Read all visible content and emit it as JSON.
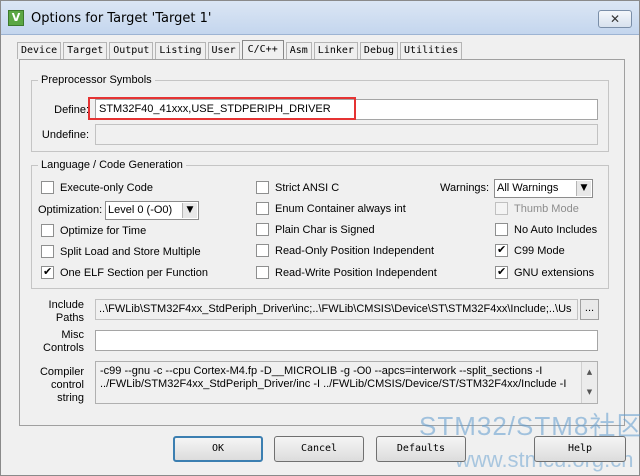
{
  "window": {
    "title": "Options for Target 'Target 1'",
    "close_glyph": "✕",
    "app_icon_letter": "V"
  },
  "tabs": [
    "Device",
    "Target",
    "Output",
    "Listing",
    "User",
    "C/C++",
    "Asm",
    "Linker",
    "Debug",
    "Utilities"
  ],
  "active_tab": "C/C++",
  "preprocessor": {
    "legend": "Preprocessor Symbols",
    "define_label": "Define:",
    "define_value": "STM32F40_41xxx,USE_STDPERIPH_DRIVER",
    "undefine_label": "Undefine:",
    "undefine_value": ""
  },
  "language": {
    "legend": "Language / Code Generation",
    "execute_only": {
      "label": "Execute-only Code",
      "checked": false
    },
    "optimization_label": "Optimization:",
    "optimization_value": "Level 0 (-O0)",
    "optimize_time": {
      "label": "Optimize for Time",
      "checked": false
    },
    "split_load": {
      "label": "Split Load and Store Multiple",
      "checked": false
    },
    "one_elf": {
      "label": "One ELF Section per Function",
      "checked": true
    },
    "strict_ansi": {
      "label": "Strict ANSI C",
      "checked": false
    },
    "enum_container": {
      "label": "Enum Container always int",
      "checked": false
    },
    "plain_char": {
      "label": "Plain Char is Signed",
      "checked": false
    },
    "ro_pi": {
      "label": "Read-Only Position Independent",
      "checked": false
    },
    "rw_pi": {
      "label": "Read-Write Position Independent",
      "checked": false
    },
    "warnings_label": "Warnings:",
    "warnings_value": "All Warnings",
    "thumb_mode": {
      "label": "Thumb Mode",
      "checked": false,
      "disabled": true
    },
    "no_auto_includes": {
      "label": "No Auto Includes",
      "checked": false
    },
    "c99": {
      "label": "C99 Mode",
      "checked": true
    },
    "gnu_ext": {
      "label": "GNU extensions",
      "checked": true
    }
  },
  "include_paths": {
    "label_line1": "Include",
    "label_line2": "Paths",
    "value": "..\\FWLib\\STM32F4xx_StdPeriph_Driver\\inc;..\\FWLib\\CMSIS\\Device\\ST\\STM32F4xx\\Include;..\\Us",
    "browse_label": "..."
  },
  "misc_controls": {
    "label_line1": "Misc",
    "label_line2": "Controls",
    "value": ""
  },
  "compiler_control": {
    "label_line1": "Compiler",
    "label_line2": "control",
    "label_line3": "string",
    "line1": "-c99 --gnu -c --cpu Cortex-M4.fp -D__MICROLIB -g -O0 --apcs=interwork --split_sections -I",
    "line2": "../FWLib/STM32F4xx_StdPeriph_Driver/inc -I ../FWLib/CMSIS/Device/ST/STM32F4xx/Include -I"
  },
  "buttons": {
    "ok": "OK",
    "cancel": "Cancel",
    "defaults": "Defaults",
    "help": "Help"
  },
  "watermark": {
    "line1": "STM32/STM8社区",
    "line2": "www.stmcu.org.cn"
  },
  "check_glyph": "✔",
  "arrow_down_glyph": "▼",
  "arrow_up_glyph": "▲"
}
